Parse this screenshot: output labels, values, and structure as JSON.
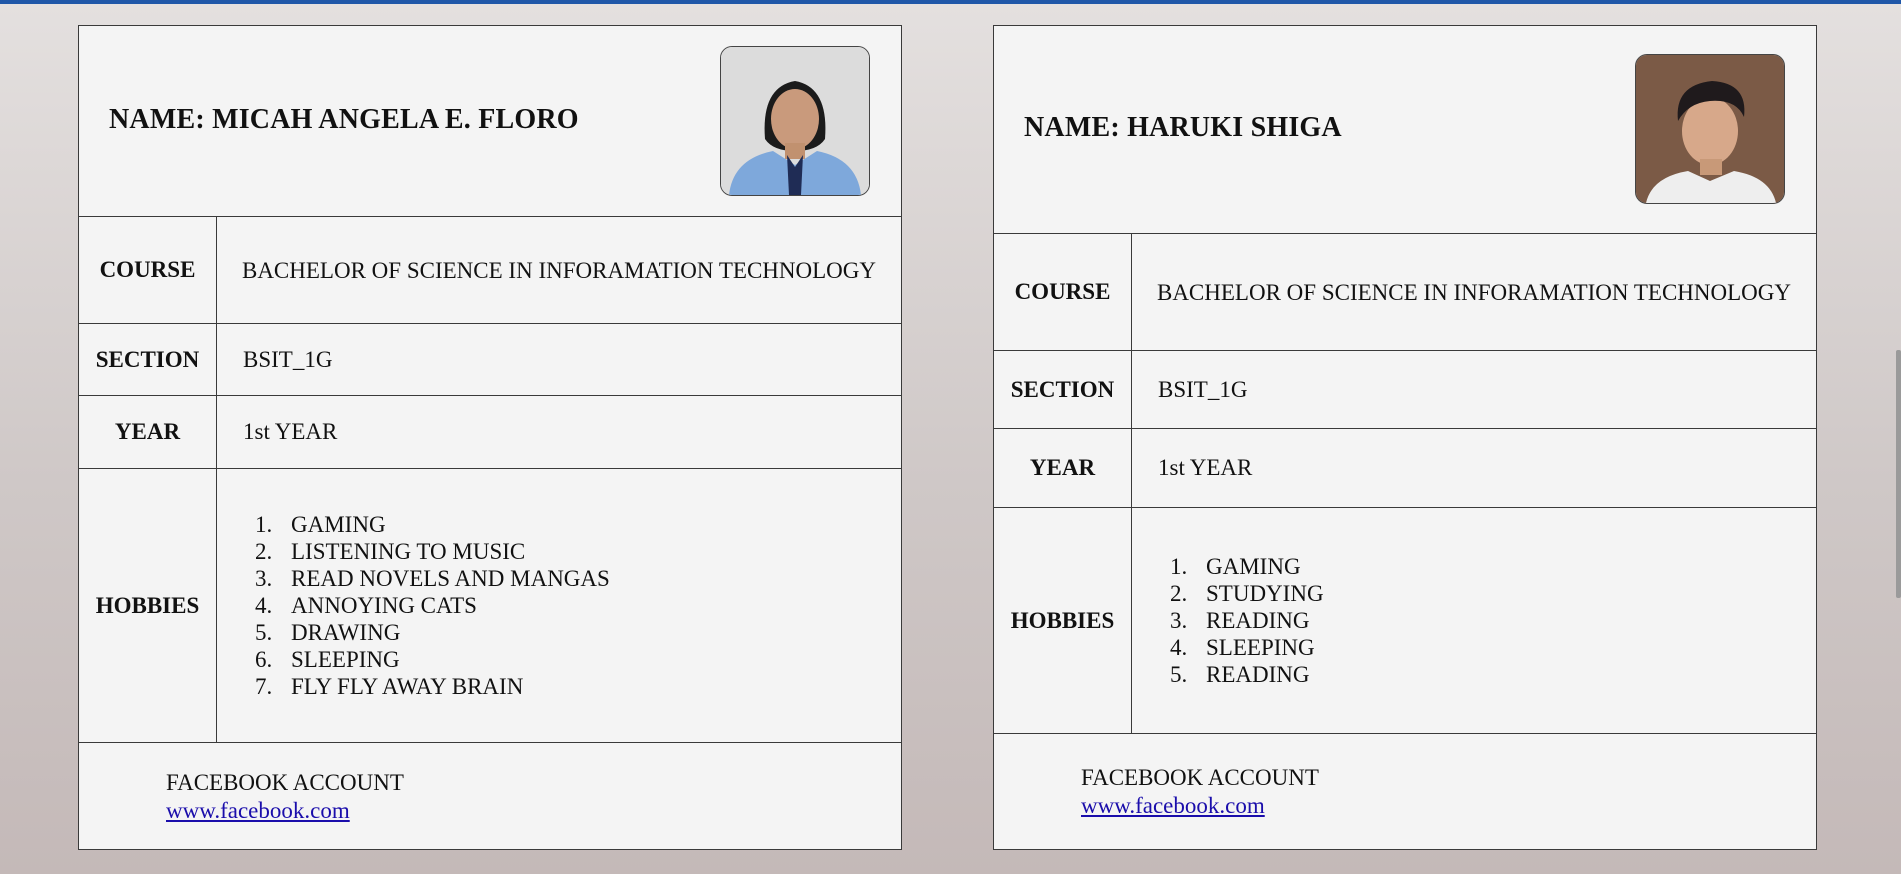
{
  "cards": [
    {
      "name_line": "NAME: MICAH ANGELA E. FLORO",
      "photo_icon": "student-photo-icon",
      "course_label": "COURSE",
      "course_value": "BACHELOR OF SCIENCE IN INFORAMATION TECHNOLOGY",
      "section_label": "SECTION",
      "section_value": "BSIT_1G",
      "year_label": "YEAR",
      "year_value": "1st YEAR",
      "hobbies_label": "HOBBIES",
      "hobbies": [
        {
          "num": "1.",
          "text": "GAMING"
        },
        {
          "num": "2.",
          "text": "LISTENING TO MUSIC"
        },
        {
          "num": "3.",
          "text": "READ NOVELS AND MANGAS"
        },
        {
          "num": "4.",
          "text": "ANNOYING CATS"
        },
        {
          "num": "5.",
          "text": "DRAWING"
        },
        {
          "num": "6.",
          "text": "SLEEPING"
        },
        {
          "num": "7.",
          "text": "FLY FLY AWAY BRAIN"
        }
      ],
      "facebook_label": "FACEBOOK ACCOUNT",
      "facebook_link": "www.facebook.com"
    },
    {
      "name_line": "NAME: HARUKI SHIGA",
      "photo_icon": "student-photo-icon",
      "course_label": "COURSE",
      "course_value": "BACHELOR OF SCIENCE IN INFORAMATION TECHNOLOGY",
      "section_label": "SECTION",
      "section_value": "BSIT_1G",
      "year_label": "YEAR",
      "year_value": "1st YEAR",
      "hobbies_label": "HOBBIES",
      "hobbies": [
        {
          "num": "1.",
          "text": "GAMING"
        },
        {
          "num": "2.",
          "text": "STUDYING"
        },
        {
          "num": "3.",
          "text": "READING"
        },
        {
          "num": "4.",
          "text": "SLEEPING"
        },
        {
          "num": "5.",
          "text": "READING"
        }
      ],
      "facebook_label": "FACEBOOK ACCOUNT",
      "facebook_link": "www.facebook.com"
    }
  ],
  "colors": {
    "accent_bar": "#1f57a8",
    "card_bg": "#f4f4f4",
    "link": "#1a0dab"
  }
}
